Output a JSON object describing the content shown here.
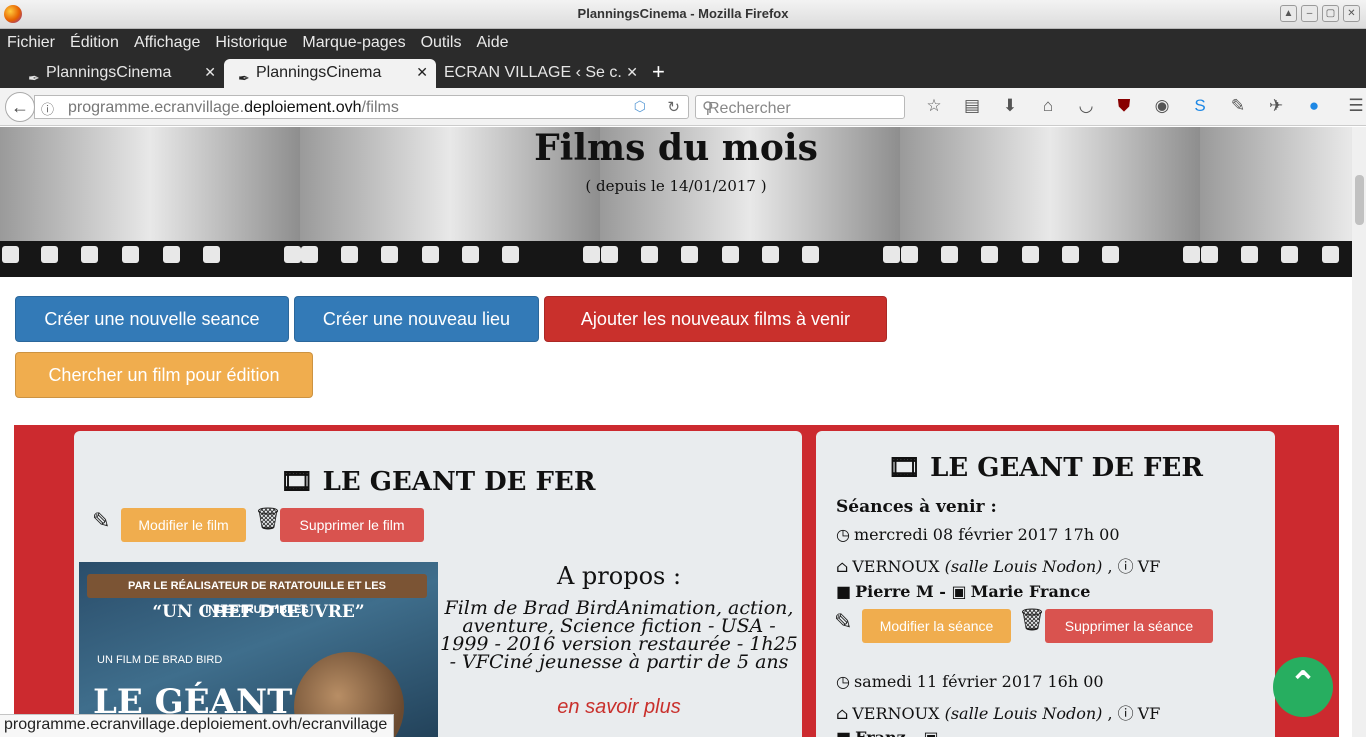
{
  "window": {
    "title": "PlanningsCinema - Mozilla Firefox"
  },
  "menu": [
    "Fichier",
    "Édition",
    "Affichage",
    "Historique",
    "Marque-pages",
    "Outils",
    "Aide"
  ],
  "tabs": [
    {
      "label": "PlanningsCinema"
    },
    {
      "label": "PlanningsCinema"
    },
    {
      "label": "ECRAN VILLAGE ‹ Se c..."
    }
  ],
  "nav": {
    "url_prefix": "programme.ecranvillage.",
    "url_domain": "deploiement.ovh",
    "url_path": "/films",
    "search_placeholder": "Rechercher"
  },
  "page": {
    "title": "Films du mois",
    "subtitle": "( depuis le 14/01/2017 )",
    "buttons": {
      "new_seance": "Créer une nouvelle seance",
      "new_lieu": "Créer une nouveau lieu",
      "add_films": "Ajouter les nouveaux films à venir",
      "search_film": "Chercher un film pour édition"
    }
  },
  "film_card": {
    "title": "LE GEANT DE FER",
    "edit_label": "Modifier le film",
    "delete_label": "Supprimer le film",
    "poster": {
      "banner": "PAR LE RÉALISATEUR DE RATATOUILLE ET LES INDESTRUCTIBLES",
      "quote": "“UN CHEF D’ŒUVRE”",
      "by": "UN FILM DE BRAD BIRD",
      "title": "LE GÉANT"
    },
    "about_title": "A propos :",
    "about_text": "Film de Brad BirdAnimation, action, aventure, Science fiction - USA - 1999 - 2016 version restaurée - 1h25 - VFCiné jeunesse à partir de 5 ans",
    "more_link": "en savoir plus"
  },
  "seance_card": {
    "title": "LE GEANT DE FER",
    "seances_heading": "Séances à venir :",
    "seances": [
      {
        "datetime": "mercredi 08 février 2017 17h 00",
        "place": "VERNOUX",
        "room": "(salle Louis Nodon)",
        "version": "VF",
        "person": "Pierre M",
        "role": "Marie France"
      },
      {
        "datetime": "samedi 11 février 2017 16h 00",
        "place": "VERNOUX",
        "room": "(salle Louis Nodon)",
        "version": "VF",
        "person": "Franz"
      }
    ],
    "edit_label": "Modifier la séance",
    "delete_label": "Supprimer la séance"
  },
  "statusbar": {
    "text": "programme.ecranvillage.deploiement.ovh/ecranvillage"
  },
  "colors": {
    "primary": "#337ab7",
    "danger": "#c9302c",
    "warning": "#f0ad4e",
    "success": "#27ae60",
    "zone": "#cc2a2f"
  },
  "icons": [
    "firefox-logo",
    "back-arrow",
    "info",
    "reload",
    "search",
    "star",
    "reader",
    "download",
    "home",
    "pocket",
    "ublock",
    "extension",
    "skype",
    "pen",
    "plane",
    "drop",
    "hamburger",
    "film",
    "pencil",
    "trash",
    "clock",
    "house",
    "info-circle",
    "video-camera",
    "briefcase",
    "chevron-up"
  ]
}
